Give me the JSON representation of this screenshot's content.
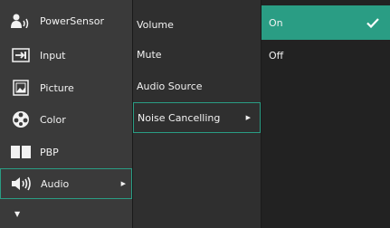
{
  "colors": {
    "accent": "#2a9d84",
    "panel_main": "#3a3a3a",
    "panel_sub": "#2f2f2f",
    "panel_opt": "#222222"
  },
  "main_menu": [
    {
      "label": "PowerSensor",
      "icon": "powersensor-icon"
    },
    {
      "label": "Input",
      "icon": "input-icon"
    },
    {
      "label": "Picture",
      "icon": "picture-icon"
    },
    {
      "label": "Color",
      "icon": "color-icon"
    },
    {
      "label": "PBP",
      "icon": "pbp-icon"
    },
    {
      "label": "Audio",
      "icon": "audio-icon",
      "selected": true
    }
  ],
  "sub_menu": [
    {
      "label": "Volume"
    },
    {
      "label": "Mute"
    },
    {
      "label": "Audio Source"
    },
    {
      "label": "Noise Cancelling",
      "selected": true
    }
  ],
  "options": [
    {
      "label": "On",
      "selected": true
    },
    {
      "label": "Off"
    }
  ]
}
